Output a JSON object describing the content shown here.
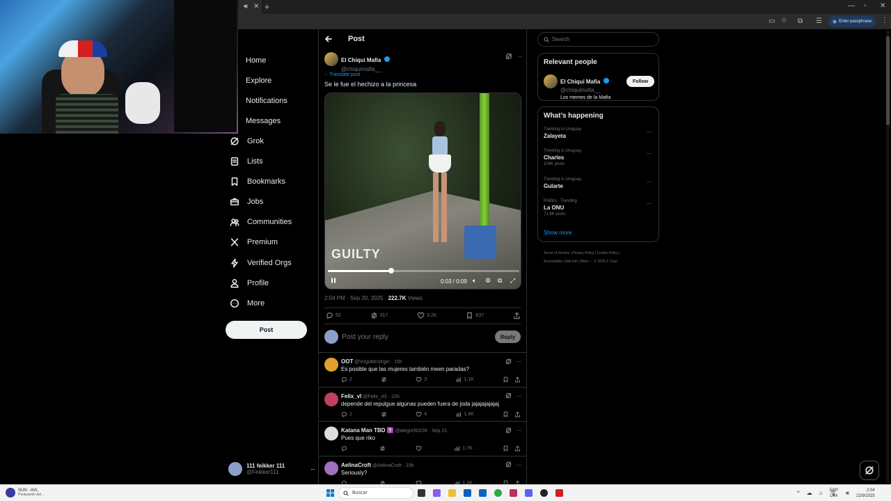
{
  "browser": {
    "passphrase_label": "Enter passphrase"
  },
  "nav": {
    "items": [
      "Home",
      "Explore",
      "Notifications",
      "Messages",
      "Grok",
      "Lists",
      "Bookmarks",
      "Jobs",
      "Communities",
      "Premium",
      "Verified Orgs",
      "Profile",
      "More"
    ],
    "post_button": "Post",
    "account": {
      "name": "111 feikker 111",
      "handle": "@Feikker111"
    }
  },
  "header": {
    "title": "Post"
  },
  "post": {
    "author": "El Chiqui Mafia",
    "handle": "@chiquimafia__",
    "translate": "Translate post",
    "text": "Se le fue el hechizo a la princesa",
    "video": {
      "overlay": "GUILTY",
      "time": "0:03 / 0:09",
      "progress": 0.33
    },
    "meta_time": "2:04 PM · Sep 20, 2025 · ",
    "views_count": "222.7K",
    "views_label": " Views",
    "stats": {
      "replies": "52",
      "reposts": "317",
      "likes": "3.2K",
      "bookmarks": "637"
    }
  },
  "composer": {
    "placeholder": "Post your reply",
    "button": "Reply"
  },
  "replies": [
    {
      "name": "OOT",
      "handle": "@VirgoMcVirgin · 15h",
      "text": "Es posible que las mujeres también meen paradas?",
      "replies": "2",
      "likes": "3",
      "views": "1.1K",
      "avatar": "#e0a030"
    },
    {
      "name": "Felix_vl",
      "handle": "@Felix_vl1 · 22h",
      "text": "depende del repulgue algunas pueden fuera de joda jajajajajajaj",
      "replies": "1",
      "likes": "4",
      "views": "1.4K",
      "avatar": "#c04060"
    },
    {
      "name": "Katana Man TBD ✝️",
      "handle": "@alegre50228 · Sep 21",
      "text": "Pues que riko",
      "replies": "",
      "likes": "",
      "views": "1.7K",
      "avatar": "#dddddd"
    },
    {
      "name": "AelinaCroft",
      "handle": "@AelinaCroft · 23h",
      "text": "Seriously?",
      "replies": "",
      "likes": "",
      "views": "1.2K",
      "avatar": "#a070c0"
    }
  ],
  "search": {
    "placeholder": "Search"
  },
  "relevant": {
    "title": "Relevant people",
    "name": "El Chiqui Mafia",
    "handle": "@chiquimafia__",
    "bio": "Los memes de la Mafia",
    "follow": "Follow"
  },
  "happening": {
    "title": "What’s happening",
    "trends": [
      {
        "context": "Trending in Uruguay",
        "topic": "Zalayeta",
        "posts": ""
      },
      {
        "context": "Trending in Uruguay",
        "topic": "Charles",
        "posts": "109K posts"
      },
      {
        "context": "Trending in Uruguay",
        "topic": "Gularte",
        "posts": ""
      },
      {
        "context": "Politics · Trending",
        "topic": "La ONU",
        "posts": "71.8K posts"
      }
    ],
    "show_more": "Show more"
  },
  "footer": {
    "line1": "Terms of Service  |  Privacy Policy  |  Cookie Policy  |",
    "line2": "Accessibility  |  Ads info  |  More ···  © 2025 X Corp."
  },
  "taskbar": {
    "weather_title": "SUN - AVL",
    "weather_sub": "Puntuación del...",
    "search": "Buscar",
    "lang1": "ESP",
    "lang2": "LAA",
    "time": "2:04",
    "date": "22/9/2025"
  }
}
